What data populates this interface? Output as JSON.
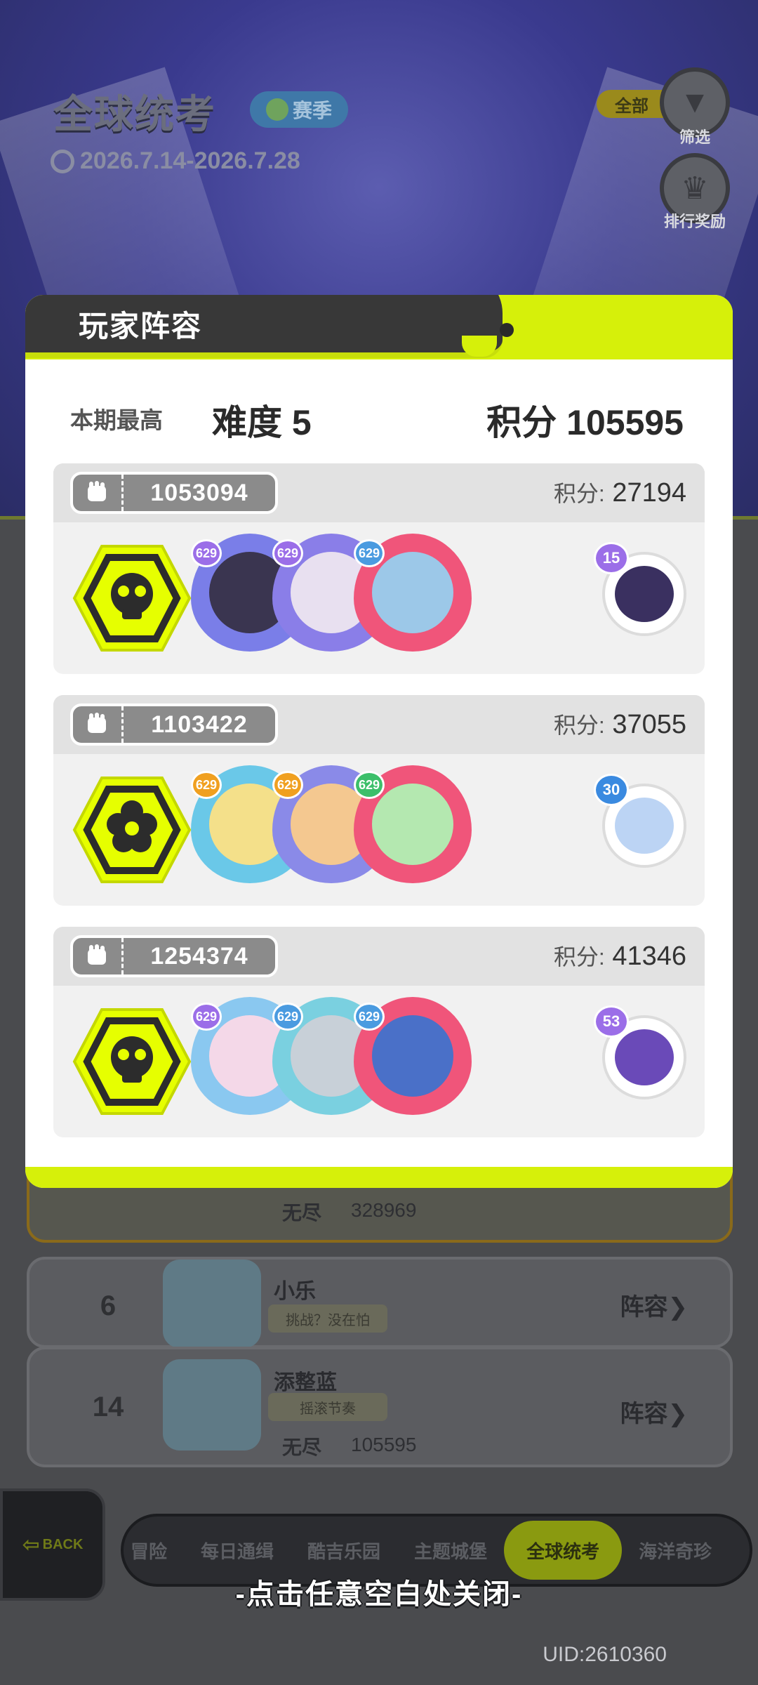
{
  "background": {
    "title": "全球统考",
    "season_label": "赛季",
    "date_range": "2026.7.14-2026.7.28",
    "filter_pill": "全部",
    "filter_label": "筛选",
    "reward_label": "排行奖励",
    "rows": [
      {
        "mode": "无尽",
        "score": "328969"
      },
      {
        "rank": "6",
        "name": "小乐",
        "tag": "挑战？没在怕",
        "lineup": "阵容"
      },
      {
        "rank": "14",
        "name": "添整蓝",
        "tag": "摇滚节奏",
        "mode": "无尽",
        "score": "105595",
        "lineup": "阵容"
      }
    ]
  },
  "modal": {
    "title": "玩家阵容",
    "best_label": "本期最高",
    "difficulty": "难度 5",
    "total_score": "积分 105595",
    "score_label": "积分:",
    "teams": [
      {
        "team_id": "1053094",
        "score": "27194",
        "badge_icon": "skull-icon",
        "chars": [
          {
            "level": "629",
            "frame": "#7a7ee8",
            "face": "#3a3550",
            "lvl_color": "#9b6ee8"
          },
          {
            "level": "629",
            "frame": "#8a7ee8",
            "face": "#e8e0f0",
            "lvl_color": "#9b6ee8"
          },
          {
            "level": "629",
            "frame": "#f0557a",
            "face": "#9cc8e8",
            "lvl_color": "#4a9be0"
          }
        ],
        "pet": {
          "level": "15",
          "color": "#3a3060",
          "lvl_color": "#9b6ee8"
        }
      },
      {
        "team_id": "1103422",
        "score": "37055",
        "badge_icon": "flower-icon",
        "chars": [
          {
            "level": "629",
            "frame": "#6ac8e8",
            "face": "#f4e08a",
            "lvl_color": "#f0a020"
          },
          {
            "level": "629",
            "frame": "#8a8ae8",
            "face": "#f4c890",
            "lvl_color": "#f0a020"
          },
          {
            "level": "629",
            "frame": "#f0557a",
            "face": "#b4e8b0",
            "lvl_color": "#3cbf6a"
          }
        ],
        "pet": {
          "level": "30",
          "color": "#bcd4f4",
          "lvl_color": "#3a8ae0"
        }
      },
      {
        "team_id": "1254374",
        "score": "41346",
        "badge_icon": "skull-icon",
        "chars": [
          {
            "level": "629",
            "frame": "#8ac8f0",
            "face": "#f4d8e8",
            "lvl_color": "#9b6ee8"
          },
          {
            "level": "629",
            "frame": "#7ad0e0",
            "face": "#c8d0d8",
            "lvl_color": "#4a9be0"
          },
          {
            "level": "629",
            "frame": "#f0557a",
            "face": "#4a70c8",
            "lvl_color": "#4a9be0"
          }
        ],
        "pet": {
          "level": "53",
          "color": "#6a4ab8",
          "lvl_color": "#9b6ee8"
        }
      }
    ]
  },
  "bottom_tabs": [
    "冒险",
    "每日通缉",
    "酷吉乐园",
    "主题城堡",
    "全球统考",
    "海洋奇珍"
  ],
  "active_tab": "全球统考",
  "back_label": "BACK",
  "close_hint": "-点击任意空白处关闭-",
  "uid": "UID:2610360",
  "colors": {
    "accent": "#d6f00a",
    "dark": "#383838"
  }
}
